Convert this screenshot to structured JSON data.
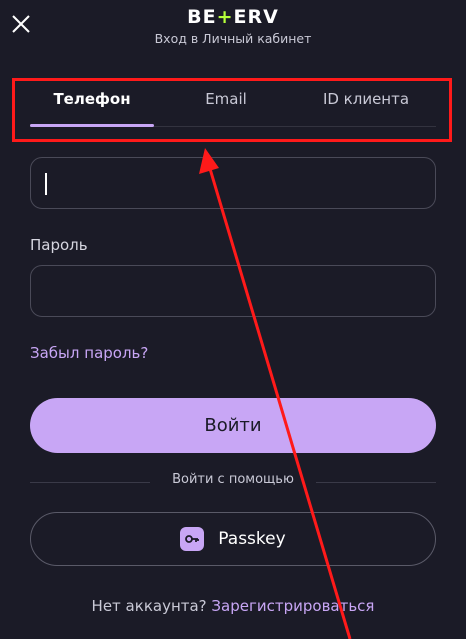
{
  "header": {
    "logo_text_left": "BE",
    "logo_text_plus": "+",
    "logo_text_right": "ERV",
    "subtitle": "Вход в Личный кабинет"
  },
  "tabs": [
    {
      "label": "Телефон",
      "active": true
    },
    {
      "label": "Email",
      "active": false
    },
    {
      "label": "ID клиента",
      "active": false
    }
  ],
  "form": {
    "phone_value": "",
    "password_label": "Пароль",
    "password_value": "",
    "forgot_link": "Забыл пароль?",
    "login_button": "Войти",
    "divider_text": "Войти с помощью",
    "passkey_button": "Passkey",
    "no_account_text": "Нет аккаунта?",
    "register_link": "Зарегистрироваться"
  },
  "colors": {
    "background": "#1b1b27",
    "accent": "#c8a6f5",
    "logo_accent": "#b6ff3a",
    "annotation": "#ff1a1a"
  }
}
